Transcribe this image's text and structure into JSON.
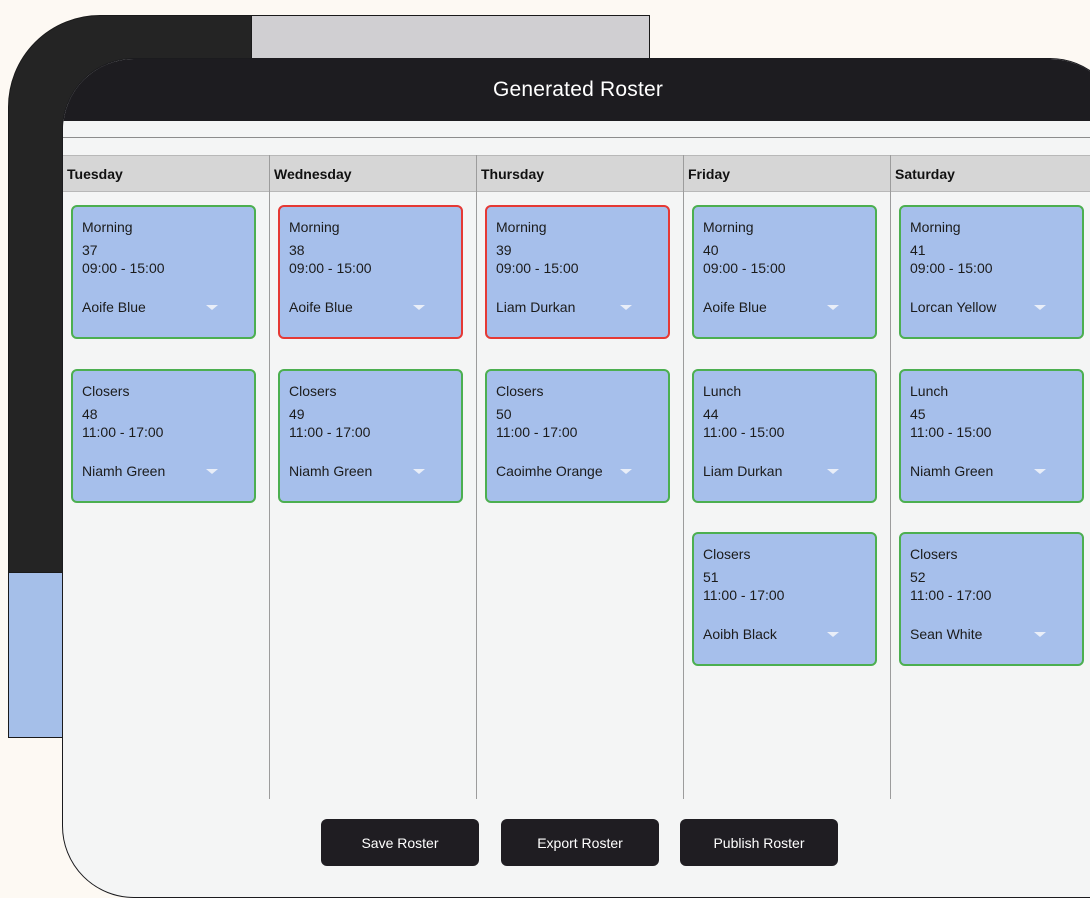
{
  "window": {
    "title": "Generated Roster"
  },
  "days": [
    {
      "name": "Tuesday",
      "shifts": [
        {
          "type": "Morning",
          "id": "37",
          "time": "09:00 - 15:00",
          "assignee": "Aoife Blue",
          "status": "ok"
        },
        {
          "type": "Closers",
          "id": "48",
          "time": "11:00 - 17:00",
          "assignee": "Niamh Green",
          "status": "ok"
        }
      ]
    },
    {
      "name": "Wednesday",
      "shifts": [
        {
          "type": "Morning",
          "id": "38",
          "time": "09:00 - 15:00",
          "assignee": "Aoife Blue",
          "status": "conflict"
        },
        {
          "type": "Closers",
          "id": "49",
          "time": "11:00 - 17:00",
          "assignee": "Niamh Green",
          "status": "ok"
        }
      ]
    },
    {
      "name": "Thursday",
      "shifts": [
        {
          "type": "Morning",
          "id": "39",
          "time": "09:00 - 15:00",
          "assignee": "Liam Durkan",
          "status": "conflict"
        },
        {
          "type": "Closers",
          "id": "50",
          "time": "11:00 - 17:00",
          "assignee": "Caoimhe Orange",
          "status": "ok"
        }
      ]
    },
    {
      "name": "Friday",
      "shifts": [
        {
          "type": "Morning",
          "id": "40",
          "time": "09:00 - 15:00",
          "assignee": "Aoife Blue",
          "status": "ok"
        },
        {
          "type": "Lunch",
          "id": "44",
          "time": "11:00 - 15:00",
          "assignee": "Liam Durkan",
          "status": "ok"
        },
        {
          "type": "Closers",
          "id": "51",
          "time": "11:00 - 17:00",
          "assignee": "Aoibh Black",
          "status": "ok"
        }
      ]
    },
    {
      "name": "Saturday",
      "shifts": [
        {
          "type": "Morning",
          "id": "41",
          "time": "09:00 - 15:00",
          "assignee": "Lorcan Yellow",
          "status": "ok"
        },
        {
          "type": "Lunch",
          "id": "45",
          "time": "11:00 - 15:00",
          "assignee": "Niamh Green",
          "status": "ok"
        },
        {
          "type": "Closers",
          "id": "52",
          "time": "11:00 - 17:00",
          "assignee": "Sean White",
          "status": "ok"
        }
      ]
    }
  ],
  "actions": {
    "save": "Save Roster",
    "export": "Export Roster",
    "publish": "Publish Roster"
  },
  "colors": {
    "ok_border": "#4caf50",
    "conflict_border": "#e53935",
    "card_bg": "#a6bfeb",
    "titlebar": "#1d1c20"
  },
  "icons": {
    "assignee_dropdown": "chevron-down-icon"
  }
}
